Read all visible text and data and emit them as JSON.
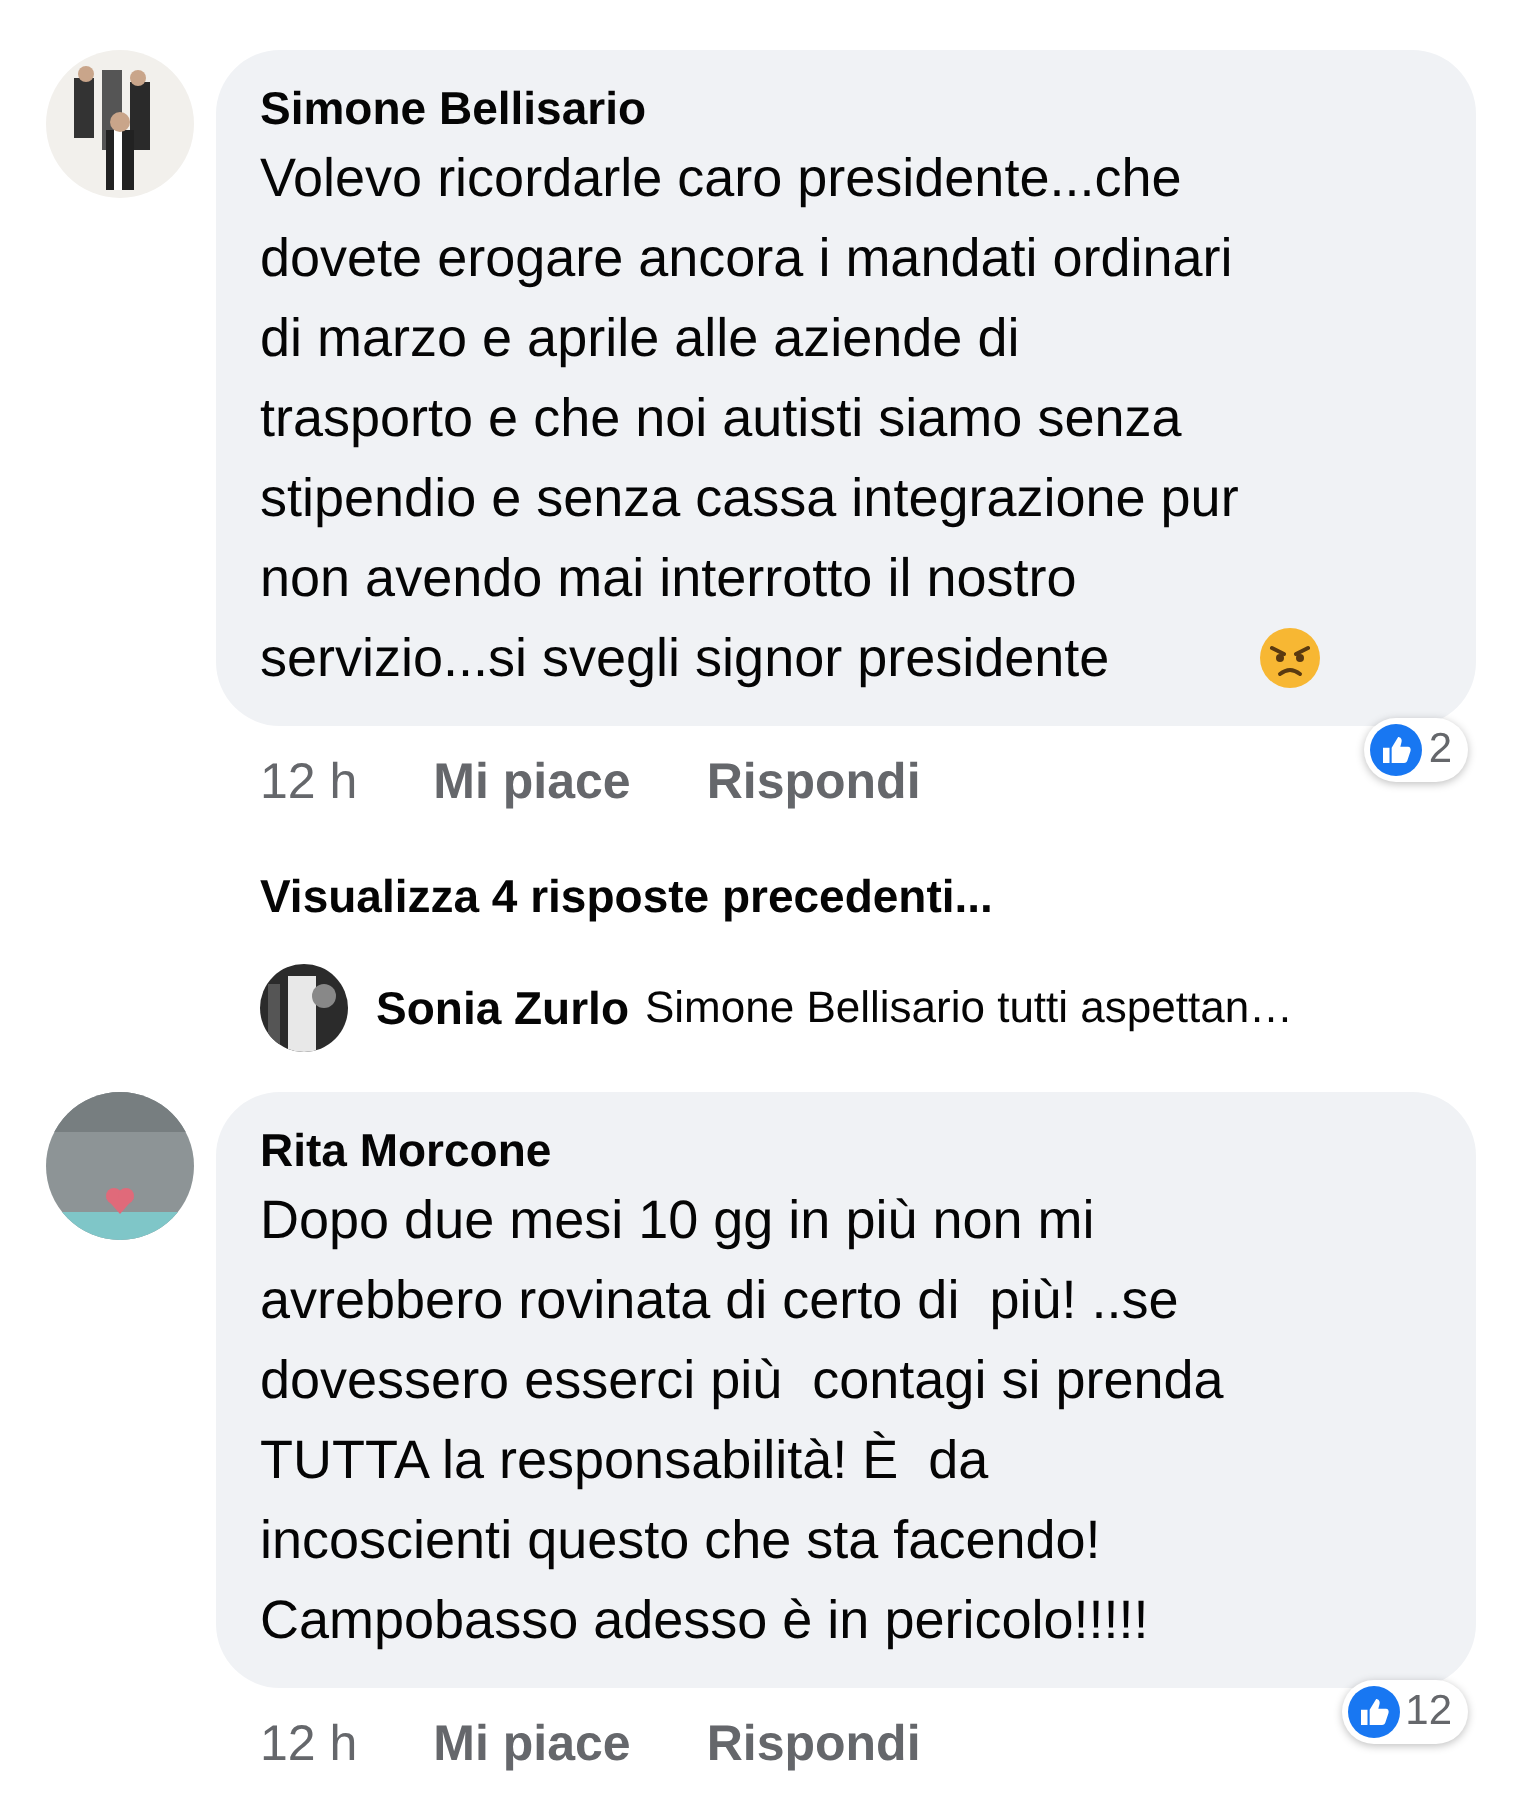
{
  "comments": [
    {
      "author": "Simone Bellisario",
      "avatar": {
        "kind": "team"
      },
      "text": "Volevo ricordarle caro presidente...che\ndovete erogare ancora i mandati ordinari\ndi marzo e aprile alle aziende di\ntrasporto e che noi autisti siamo senza\nstipendio e senza cassa integrazione pur\nnon avendo mai interrotto il nostro\nservizio...si svegli signor presidente",
      "emoji": {
        "kind": "angry"
      },
      "time": "12 h",
      "like": "Mi piace",
      "reply": "Rispondi",
      "reactions": "2",
      "more_replies": "Visualizza 4 risposte precedenti...",
      "replies": [
        {
          "author": "Sonia Zurlo",
          "text": "Simone Bellisario tutti aspettan…"
        }
      ]
    },
    {
      "author": "Rita Morcone",
      "avatar": {
        "kind": "sign"
      },
      "text": "Dopo due mesi 10 gg in più non mi\navrebbero rovinata di certo di  più! ..se\ndovessero esserci più  contagi si prenda\nTUTTA la responsabilità! È  da\nincoscienti questo che sta facendo!\nCampobasso adesso è in pericolo!!!!!",
      "time": "12 h",
      "like": "Mi piace",
      "reply": "Rispondi",
      "reactions": "12"
    }
  ]
}
